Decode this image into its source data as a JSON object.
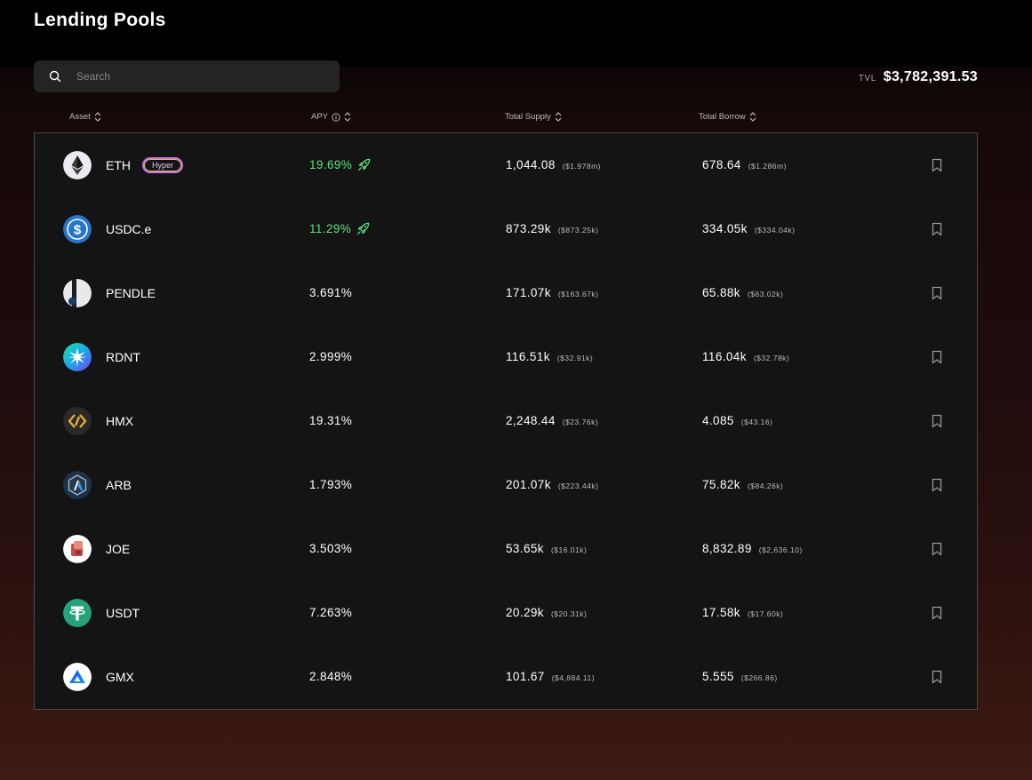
{
  "page": {
    "title": "Lending Pools"
  },
  "search": {
    "placeholder": "Search",
    "value": ""
  },
  "tvl": {
    "label": "TVL",
    "value": "$3,782,391.53"
  },
  "columns": {
    "asset": "Asset",
    "apy": "APY",
    "supply": "Total Supply",
    "borrow": "Total Borrow"
  },
  "colors": {
    "apy_highlight": "#5ee37a",
    "badge_border": "#c576e8"
  },
  "pools": [
    {
      "symbol": "ETH",
      "icon": "eth-icon",
      "badge": "Hyper",
      "apy": "19.69%",
      "apy_highlight": true,
      "supply": "1,044.08",
      "supply_usd": "($1.978m)",
      "borrow": "678.64",
      "borrow_usd": "($1.286m)"
    },
    {
      "symbol": "USDC.e",
      "icon": "usdc-icon",
      "apy": "11.29%",
      "apy_highlight": true,
      "supply": "873.29k",
      "supply_usd": "($873.25k)",
      "borrow": "334.05k",
      "borrow_usd": "($334.04k)"
    },
    {
      "symbol": "PENDLE",
      "icon": "pendle-icon",
      "apy": "3.691%",
      "apy_highlight": false,
      "supply": "171.07k",
      "supply_usd": "($163.67k)",
      "borrow": "65.88k",
      "borrow_usd": "($63.02k)"
    },
    {
      "symbol": "RDNT",
      "icon": "rdnt-icon",
      "apy": "2.999%",
      "apy_highlight": false,
      "supply": "116.51k",
      "supply_usd": "($32.91k)",
      "borrow": "116.04k",
      "borrow_usd": "($32.78k)"
    },
    {
      "symbol": "HMX",
      "icon": "hmx-icon",
      "apy": "19.31%",
      "apy_highlight": false,
      "supply": "2,248.44",
      "supply_usd": "($23.76k)",
      "borrow": "4.085",
      "borrow_usd": "($43.16)"
    },
    {
      "symbol": "ARB",
      "icon": "arb-icon",
      "apy": "1.793%",
      "apy_highlight": false,
      "supply": "201.07k",
      "supply_usd": "($223.44k)",
      "borrow": "75.82k",
      "borrow_usd": "($84.26k)"
    },
    {
      "symbol": "JOE",
      "icon": "joe-icon",
      "apy": "3.503%",
      "apy_highlight": false,
      "supply": "53.65k",
      "supply_usd": "($16.01k)",
      "borrow": "8,832.89",
      "borrow_usd": "($2,636.10)"
    },
    {
      "symbol": "USDT",
      "icon": "usdt-icon",
      "apy": "7.263%",
      "apy_highlight": false,
      "supply": "20.29k",
      "supply_usd": "($20.31k)",
      "borrow": "17.58k",
      "borrow_usd": "($17.60k)"
    },
    {
      "symbol": "GMX",
      "icon": "gmx-icon",
      "apy": "2.848%",
      "apy_highlight": false,
      "supply": "101.67",
      "supply_usd": "($4,884.11)",
      "borrow": "5.555",
      "borrow_usd": "($266.86)"
    }
  ]
}
